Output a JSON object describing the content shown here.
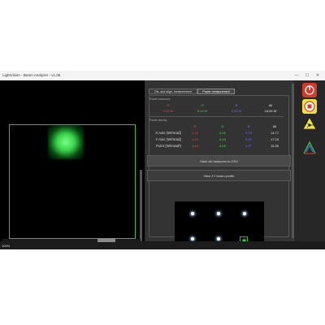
{
  "window": {
    "title": "LightVision - Beam Analyzer - v1.06",
    "zoom": "100%"
  },
  "controls": {
    "minimize": "—",
    "maximize": "☐",
    "close": "✕"
  },
  "tabs": [
    {
      "label": "Dis. and align. measurement",
      "active": false
    },
    {
      "label": "Power measurement",
      "active": true
    }
  ],
  "power_measures": {
    "title": "Power measures",
    "headers": [
      "R",
      "G",
      "B",
      "All"
    ],
    "values": [
      "3.03 W",
      "8.16 W",
      "5.35 W",
      "16.54 W"
    ]
  },
  "power_density": {
    "title": "Power density",
    "headers": [
      "R",
      "G",
      "B",
      "All"
    ],
    "rows": [
      {
        "label": "X Axis (W/mrad)",
        "values": [
          "4.70",
          "6.25",
          "3.74",
          "14.77"
        ]
      },
      {
        "label": "Y Axis (W/mrad)",
        "values": [
          "4.75",
          "6.48",
          "5.92",
          "17.23"
        ]
      },
      {
        "label": "Point (W/mrad²)",
        "values": [
          "4.44",
          "6.68",
          "4.27",
          "15.39"
        ]
      }
    ]
  },
  "buttons": {
    "save_csv": "Save all measures to CSV",
    "view_profile": "View XY beam profile"
  },
  "sidebar_icons": [
    "power-button-icon",
    "stop-button-icon",
    "laser-warning-icon",
    "beam-analyzer-logo-icon"
  ],
  "colors": {
    "red": "#e04848",
    "green": "#4ccf4c",
    "blue": "#6b6bff",
    "roi": "#2ec22e",
    "accent_red": "#d43a2a",
    "accent_yellow": "#f4e23c"
  }
}
